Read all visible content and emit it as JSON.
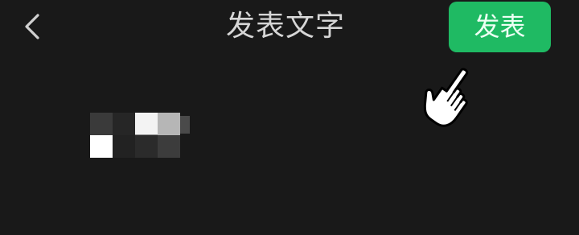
{
  "header": {
    "back_icon": "chevron-left-icon",
    "title": "发表文字",
    "publish_label": "发表"
  },
  "overlay": {
    "pointer_icon": "hand-pointer-icon"
  },
  "editor": {
    "content_icon": "pixelated-mosaic-icon"
  },
  "colors": {
    "background": "#191919",
    "accent": "#1fba63",
    "title_text": "#d6d6d6"
  }
}
